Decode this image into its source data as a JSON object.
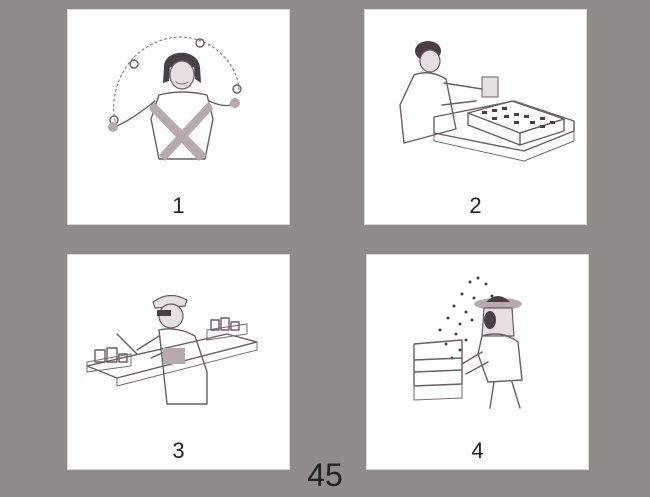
{
  "cards": [
    {
      "number": "1",
      "subject": "juggler"
    },
    {
      "number": "2",
      "subject": "circuit-board-worker"
    },
    {
      "number": "3",
      "subject": "lab-technician"
    },
    {
      "number": "4",
      "subject": "beekeeper"
    }
  ],
  "page_number": "45",
  "colors": {
    "background": "#8f8c89",
    "card": "#ffffff",
    "ink": "#6b5d63",
    "text": "#222222"
  }
}
